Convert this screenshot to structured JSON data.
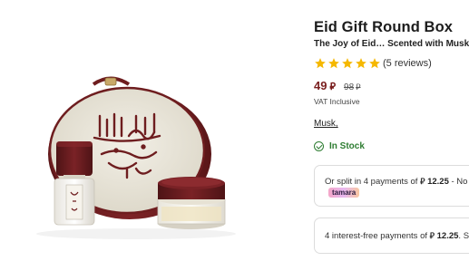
{
  "product": {
    "title": "Eid Gift Round Box",
    "subtitle": "The Joy of Eid… Scented with Musk",
    "rating": 5,
    "reviews": "(5 reviews)",
    "price": "49",
    "old_price": "98",
    "currency_symbol": "⃁",
    "vat": "VAT Inclusive",
    "brand": "Musk,",
    "stock": "In Stock",
    "image_text": "كل عام وانتم بخير",
    "bottle_label": "مسك"
  },
  "payments": {
    "tamara": {
      "text_prefix": "Or split in 4 payments of",
      "amount": "12.25",
      "text_suffix": "- No la",
      "badge": "tamara"
    },
    "tabby": {
      "text_prefix": "4 interest-free payments of",
      "amount": "12.25",
      "text_suffix": ". Sh"
    }
  },
  "colors": {
    "brand_maroon": "#6e1d1f",
    "price_red": "#7a1f1f",
    "star": "#f5b800",
    "in_stock_green": "#2e7d32",
    "box_cream": "#ece8dc"
  },
  "icons": {
    "star": "star-icon",
    "in_stock": "check-circle-icon"
  }
}
